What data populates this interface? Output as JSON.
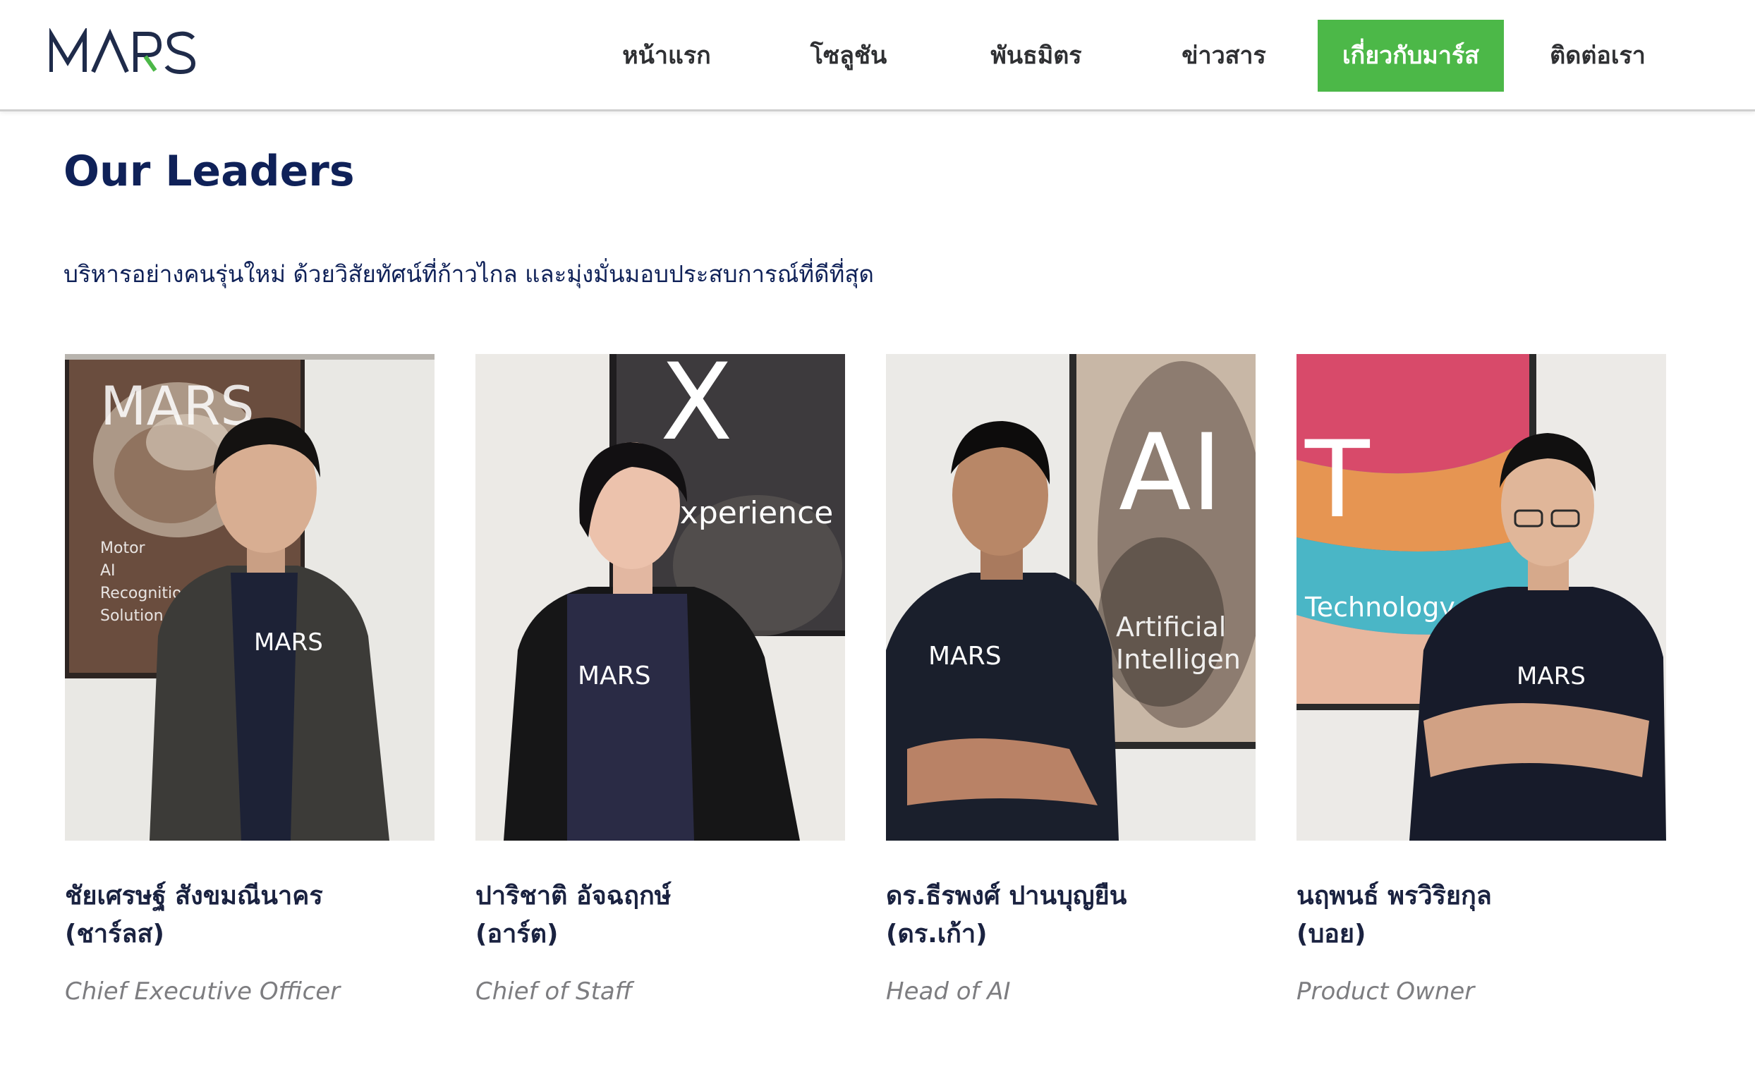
{
  "brand": {
    "logo_text": "MARS",
    "colors": {
      "navy": "#0f2158",
      "green": "#4cb848",
      "nav_text": "#2f3033",
      "role_text": "#7d7d80"
    }
  },
  "nav": {
    "items": [
      {
        "label": "หน้าแรก",
        "active": false
      },
      {
        "label": "โซลูชัน",
        "active": false
      },
      {
        "label": "พันธมิตร",
        "active": false
      },
      {
        "label": "ข่าวสาร",
        "active": false
      },
      {
        "label": "เกี่ยวกับมาร์ส",
        "active": true
      },
      {
        "label": "ติดต่อเรา",
        "active": false
      }
    ]
  },
  "section": {
    "title": "Our Leaders",
    "subtitle": "บริหารอย่างคนรุ่นใหม่ ด้วยวิสัยทัศน์ที่ก้าวไกล และมุ่งมั่นมอบประสบการณ์ที่ดีที่สุด"
  },
  "leaders": [
    {
      "name": "ชัยเศรษฐ์ สังขมณีนาคร",
      "nickname": "(ชาร์ลส)",
      "role": "Chief Executive Officer",
      "photo": {
        "poster_big": "MARS",
        "poster_lines": [
          "Motor",
          "AI",
          "Recognition",
          "Solution"
        ],
        "shirt": "MARS"
      }
    },
    {
      "name": "ปาริชาติ อัจฉฤกษ์",
      "nickname": "(อาร์ต)",
      "role": "Chief of Staff",
      "photo": {
        "poster_big": "X",
        "poster_lines": [
          "Experience"
        ],
        "shirt": "MARS"
      }
    },
    {
      "name": "ดร.ธีรพงศ์ ปานบุญยืน",
      "nickname": "(ดร.เก้า)",
      "role": "Head of AI",
      "photo": {
        "poster_big": "AI",
        "poster_lines": [
          "Artificial",
          "Intelligen"
        ],
        "shirt": "MARS"
      }
    },
    {
      "name": "นฤพนธ์ พรวิริยกุล",
      "nickname": "(บอย)",
      "role": "Product Owner",
      "photo": {
        "poster_big": "T",
        "poster_lines": [
          "Technology"
        ],
        "shirt": "MARS"
      }
    }
  ]
}
